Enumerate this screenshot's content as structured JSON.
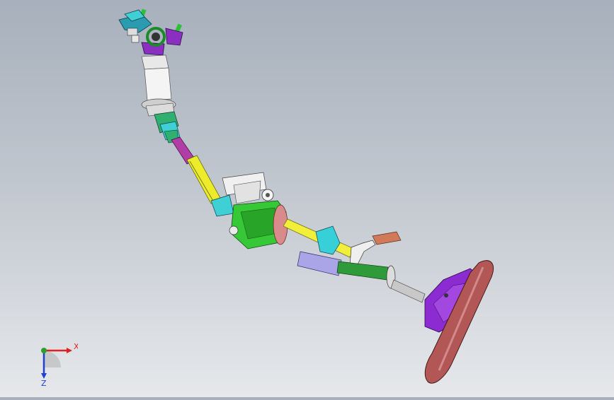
{
  "viewport": {
    "background_top": "#a7b0bc",
    "background_bottom": "#e6e8eb"
  },
  "model": {
    "parts": {
      "mount_bracket": "#2a9bb0",
      "mount_accent": "#8a2fc0",
      "green_bolt": "#2fbf3a",
      "white_tube": "#f2f2f2",
      "yoke_green": "#2fb070",
      "intermediate_shaft_purple": "#b13ea6",
      "intermediate_shaft_yellow": "#ecec2a",
      "cyan_joint": "#3fd0d6",
      "column_housing": "#36c836",
      "column_shaft_yellow": "#f1ef3a",
      "shroud_blue": "#a9a5e6",
      "bracket_cyan": "#37cfd8",
      "column_tube_green": "#2f9a3a",
      "wheel_rim": "#b25656",
      "wheel_hub": "#8b2bd1"
    }
  },
  "triad": {
    "x_label": "X",
    "z_label": "Z",
    "x_color": "#e02020",
    "y_color": "#2aa02a",
    "z_color": "#2040d0"
  }
}
